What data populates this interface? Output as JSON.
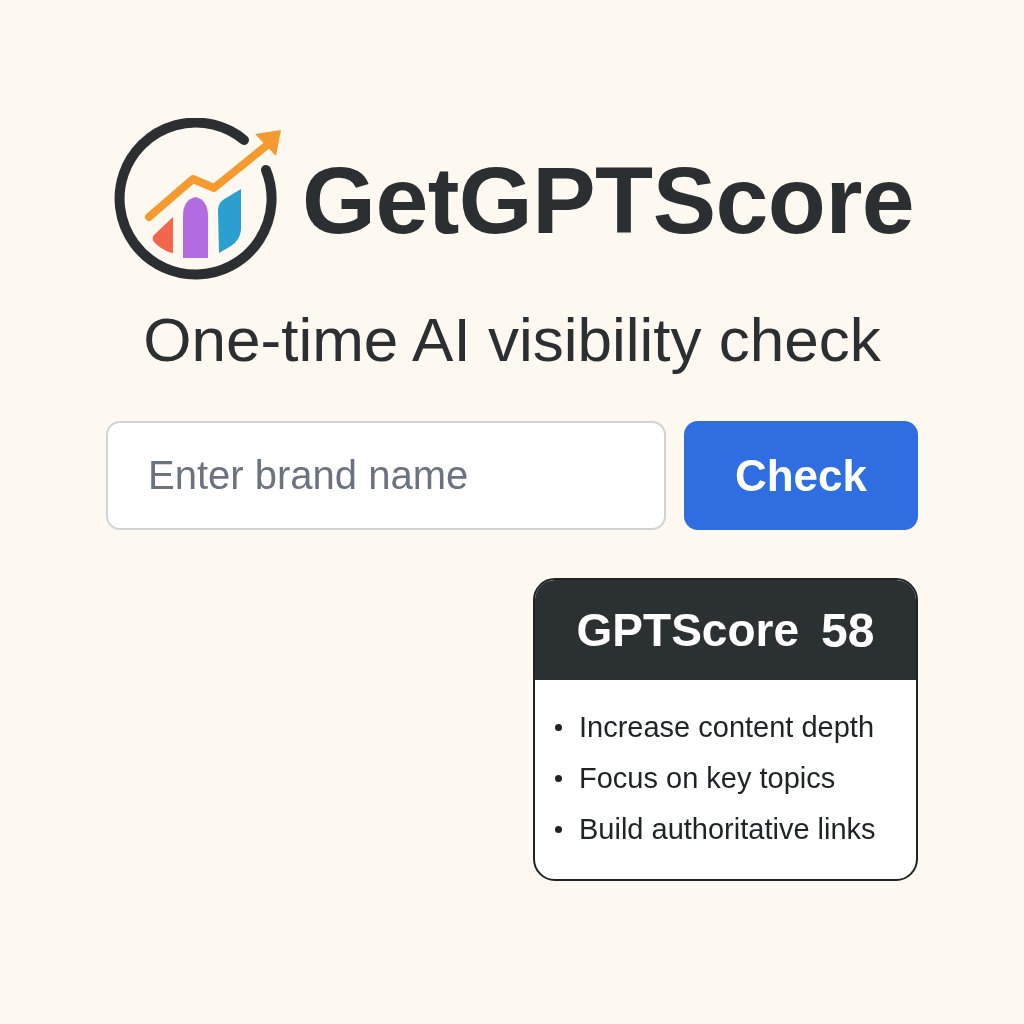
{
  "brand": {
    "name": "GetGPTScore"
  },
  "tagline": "One-time AI visibility check",
  "search": {
    "placeholder": "Enter brand name",
    "button": "Check"
  },
  "score_card": {
    "label": "GPTScore",
    "score": "58",
    "tips": [
      "Increase content depth",
      "Focus on key topics",
      "Build authoritative links"
    ]
  }
}
